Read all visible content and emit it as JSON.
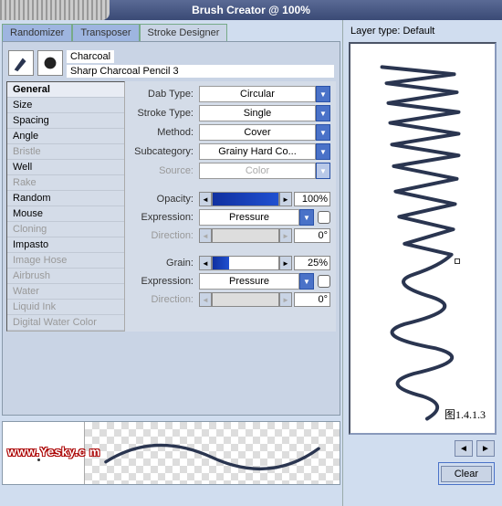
{
  "window": {
    "title": "Brush Creator @ 100%"
  },
  "tabs": {
    "randomizer": "Randomizer",
    "transposer": "Transposer",
    "stroke_designer": "Stroke Designer"
  },
  "brush": {
    "category": "Charcoal",
    "name": "Sharp Charcoal Pencil 3"
  },
  "categories": [
    {
      "label": "General",
      "active": true
    },
    {
      "label": "Size"
    },
    {
      "label": "Spacing"
    },
    {
      "label": "Angle"
    },
    {
      "label": "Bristle",
      "disabled": true
    },
    {
      "label": "Well"
    },
    {
      "label": "Rake",
      "disabled": true
    },
    {
      "label": "Random"
    },
    {
      "label": "Mouse"
    },
    {
      "label": "Cloning",
      "disabled": true
    },
    {
      "label": "Impasto"
    },
    {
      "label": "Image Hose",
      "disabled": true
    },
    {
      "label": "Airbrush",
      "disabled": true
    },
    {
      "label": "Water",
      "disabled": true
    },
    {
      "label": "Liquid Ink",
      "disabled": true
    },
    {
      "label": "Digital Water Color",
      "disabled": true
    }
  ],
  "props": {
    "dab_type": {
      "label": "Dab Type:",
      "value": "Circular"
    },
    "stroke_type": {
      "label": "Stroke Type:",
      "value": "Single"
    },
    "method": {
      "label": "Method:",
      "value": "Cover"
    },
    "subcategory": {
      "label": "Subcategory:",
      "value": "Grainy Hard Co..."
    },
    "source": {
      "label": "Source:",
      "value": "Color"
    },
    "opacity": {
      "label": "Opacity:",
      "value": "100%"
    },
    "expression1": {
      "label": "Expression:",
      "value": "Pressure"
    },
    "direction1": {
      "label": "Direction:",
      "value": "0°"
    },
    "grain": {
      "label": "Grain:",
      "value": "25%"
    },
    "expression2": {
      "label": "Expression:",
      "value": "Pressure"
    },
    "direction2": {
      "label": "Direction:",
      "value": "0°"
    }
  },
  "right": {
    "layer_type": "Layer type: Default",
    "figure": "图1.4.1.3",
    "clear": "Clear"
  },
  "watermark": "www.Yesky.c    m"
}
